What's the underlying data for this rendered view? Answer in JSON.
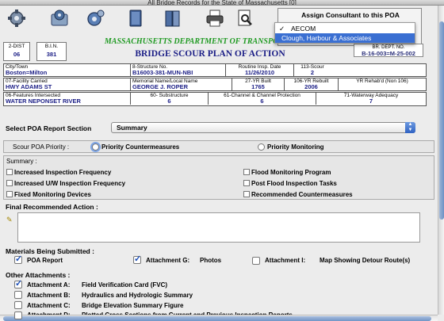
{
  "window": {
    "title": "All Bridge Records for the State of Massachusetts [0]"
  },
  "toolbar": {
    "tools": [
      "gear-icon",
      "gear-settings-icon",
      "gear-blue-icon",
      "book-icon",
      "books-icon",
      "printer-icon",
      "preview-icon"
    ]
  },
  "assign": {
    "title": "Assign Consultant to this POA",
    "options": [
      "AECOM",
      "Clough, Harbour & Associates"
    ],
    "checked_option": "AECOM",
    "highlighted_option": "Clough, Harbour & Associates"
  },
  "header": {
    "dist_label": "2-DIST",
    "dist_value": "06",
    "bin_label": "B.I.N.",
    "bin_value": "381",
    "agency": "MASSACHUSETTS DEPARTMENT OF TRANSPORTATION",
    "plan_title": "BRIDGE SCOUR PLAN OF ACTION",
    "bkdept_label": "BR. DEPT. NO.",
    "bkdept_value": "B-16-003=M-25-002"
  },
  "row1": {
    "city_label": "City/Town",
    "city_value": "Boston=Milton",
    "structure_label": "8-Structure No.",
    "structure_value": "B16003-381-MUN-NBI",
    "insp_label": "Routine Insp. Date",
    "insp_value": "11/26/2010",
    "scour_label": "113-Scour",
    "scour_value": "2"
  },
  "row2": {
    "facility_label": "07-Facility Carried",
    "facility_value": "HWY   ADAMS ST",
    "memorial_label": "Memorial Name/Local Name",
    "memorial_value": "GEORGE J. ROPER",
    "built_label": "27-YR Built",
    "built_value": "1765",
    "rebuilt_label": "106-YR Rebuilt",
    "rebuilt_value": "2006",
    "rehab_label": "YR Rehab'd (Non 106)",
    "rehab_value": ""
  },
  "row3": {
    "features_label": "06-Features Intersected",
    "features_value": "WATER NEPONSET RIVER",
    "substructure_label": "60- Substructure",
    "substructure_value": "6",
    "channel_label": "61-Channel & Channel Protection",
    "channel_value": "6",
    "waterway_label": "71-Waterway Adequacy",
    "waterway_value": "7"
  },
  "poa_section": {
    "label": "Select POA Report Section",
    "value": "Summary"
  },
  "priority": {
    "label": "Scour POA Priority :",
    "options": [
      "Priority Countermeasures",
      "Priority Monitoring"
    ]
  },
  "summary": {
    "label": "Summary :",
    "items_left": [
      "Increased Inspection Frequency",
      "Increased U/W Inspection Frequency",
      "Fixed Monitoring Devices"
    ],
    "items_right": [
      "Flood Monitoring Program",
      "Post Flood Inspection Tasks",
      "Recommended Countermeasures"
    ]
  },
  "final_action": {
    "label": "Final Recommended Action :"
  },
  "materials": {
    "label": "Materials Being Submitted :",
    "poa_report": "POA Report",
    "attachment_g_label": "Attachment G:",
    "attachment_g_value": "Photos",
    "attachment_i_label": "Attachment I:",
    "attachment_i_value": "Map Showing Detour Route(s)"
  },
  "other": {
    "label": "Other Attachments :",
    "items": [
      {
        "label": "Attachment A:",
        "value": "Field Verification Card (FVC)",
        "checked": true
      },
      {
        "label": "Attachment B:",
        "value": "Hydraulics and Hydrologic Summary",
        "checked": false
      },
      {
        "label": "Attachment C:",
        "value": "Bridge Elevation Summary Figure",
        "checked": false
      },
      {
        "label": "Attachment D:",
        "value": "Plotted Cross Sections from Current and Previous Inspection Reports",
        "checked": false
      }
    ]
  }
}
